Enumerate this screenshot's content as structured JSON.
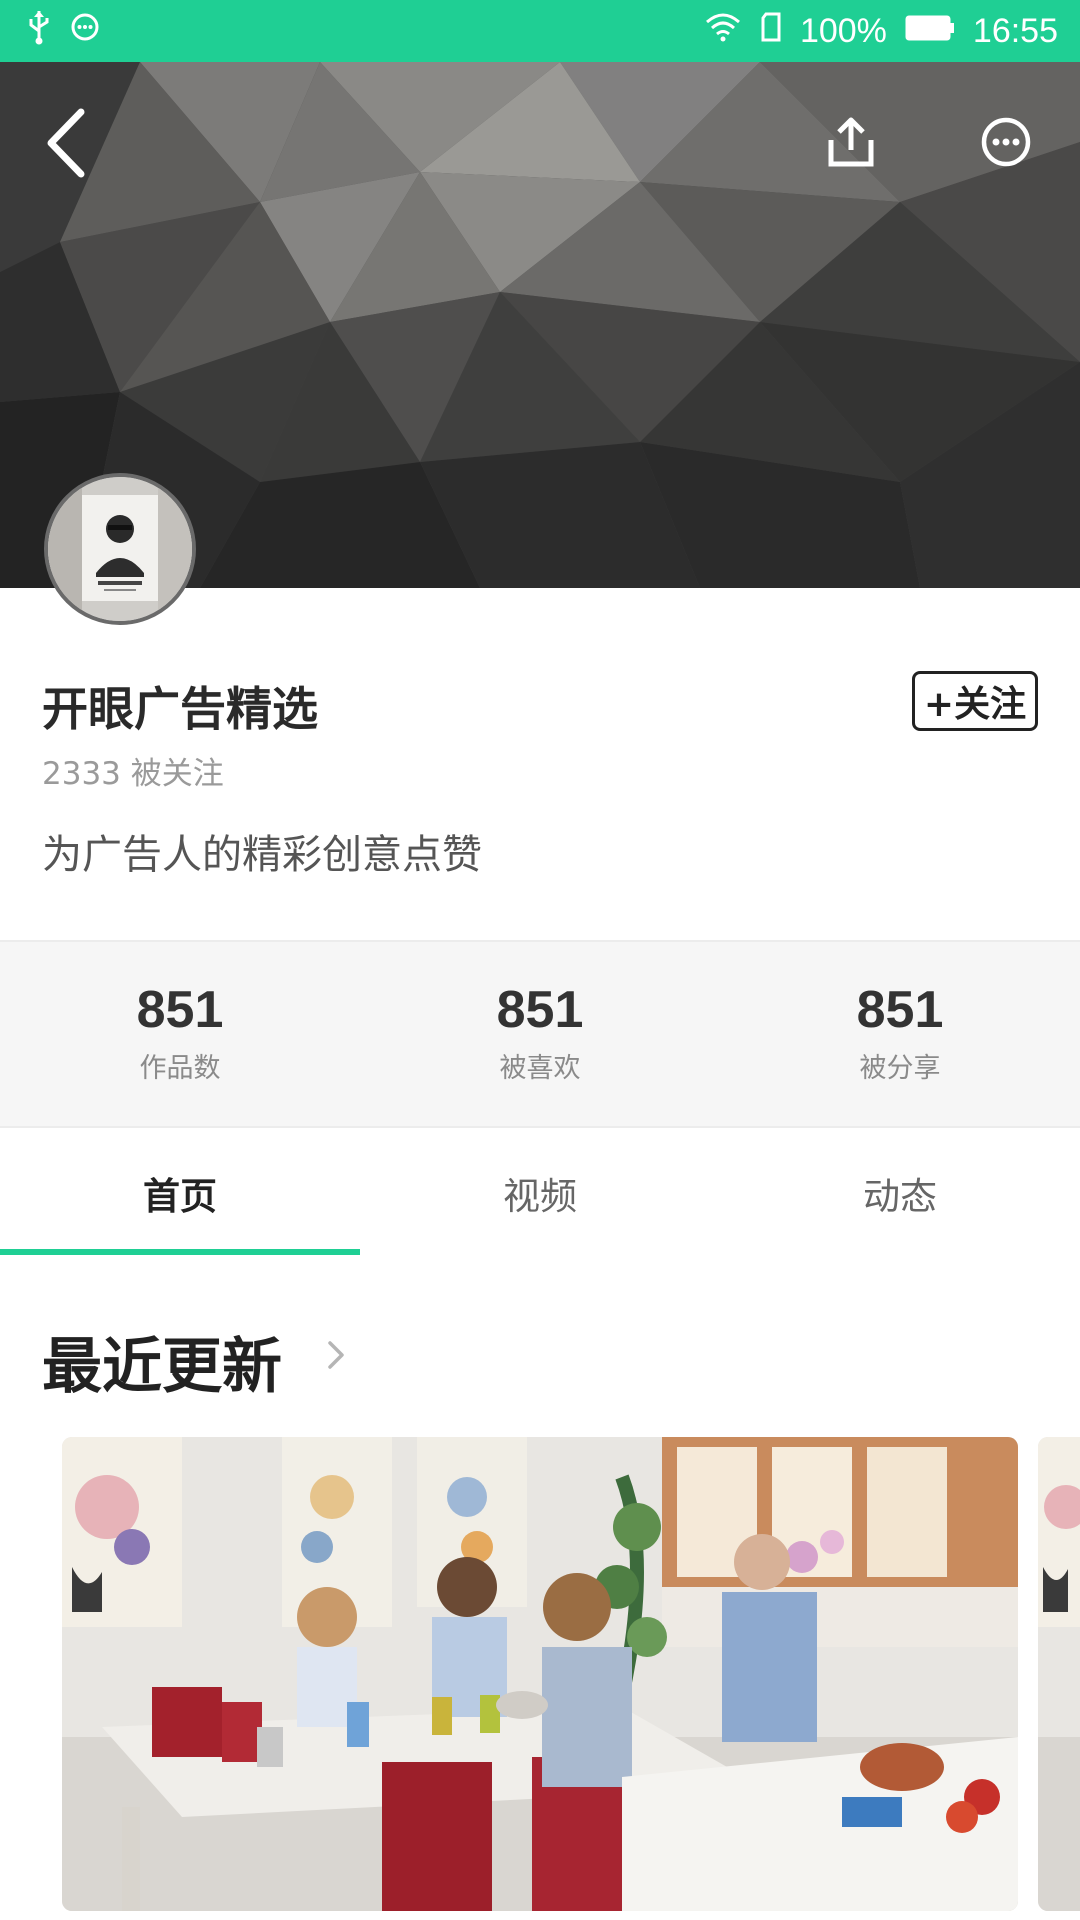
{
  "status_bar": {
    "battery": "100%",
    "time": "16:55",
    "left_icons": [
      "usb-icon",
      "message-icon"
    ],
    "right_icons": [
      "wifi-icon",
      "sim-icon",
      "battery-icon"
    ]
  },
  "header": {
    "back_icon": "chevron-left-icon",
    "share_icon": "share-icon",
    "more_icon": "more-icon"
  },
  "profile": {
    "name": "开眼广告精选",
    "follow_label": "+关注",
    "followers": "2333 被关注",
    "bio": "为广告人的精彩创意点赞"
  },
  "stats": [
    {
      "value": "851",
      "label": "作品数"
    },
    {
      "value": "851",
      "label": "被喜欢"
    },
    {
      "value": "851",
      "label": "被分享"
    }
  ],
  "tabs": [
    {
      "label": "首页",
      "active": true
    },
    {
      "label": "视频",
      "active": false
    },
    {
      "label": "动态",
      "active": false
    }
  ],
  "section": {
    "title": "最近更新"
  },
  "colors": {
    "accent": "#1fcf94",
    "banner": "#4a4a4a",
    "text_primary": "#222222",
    "text_secondary": "#9a9a9a"
  }
}
